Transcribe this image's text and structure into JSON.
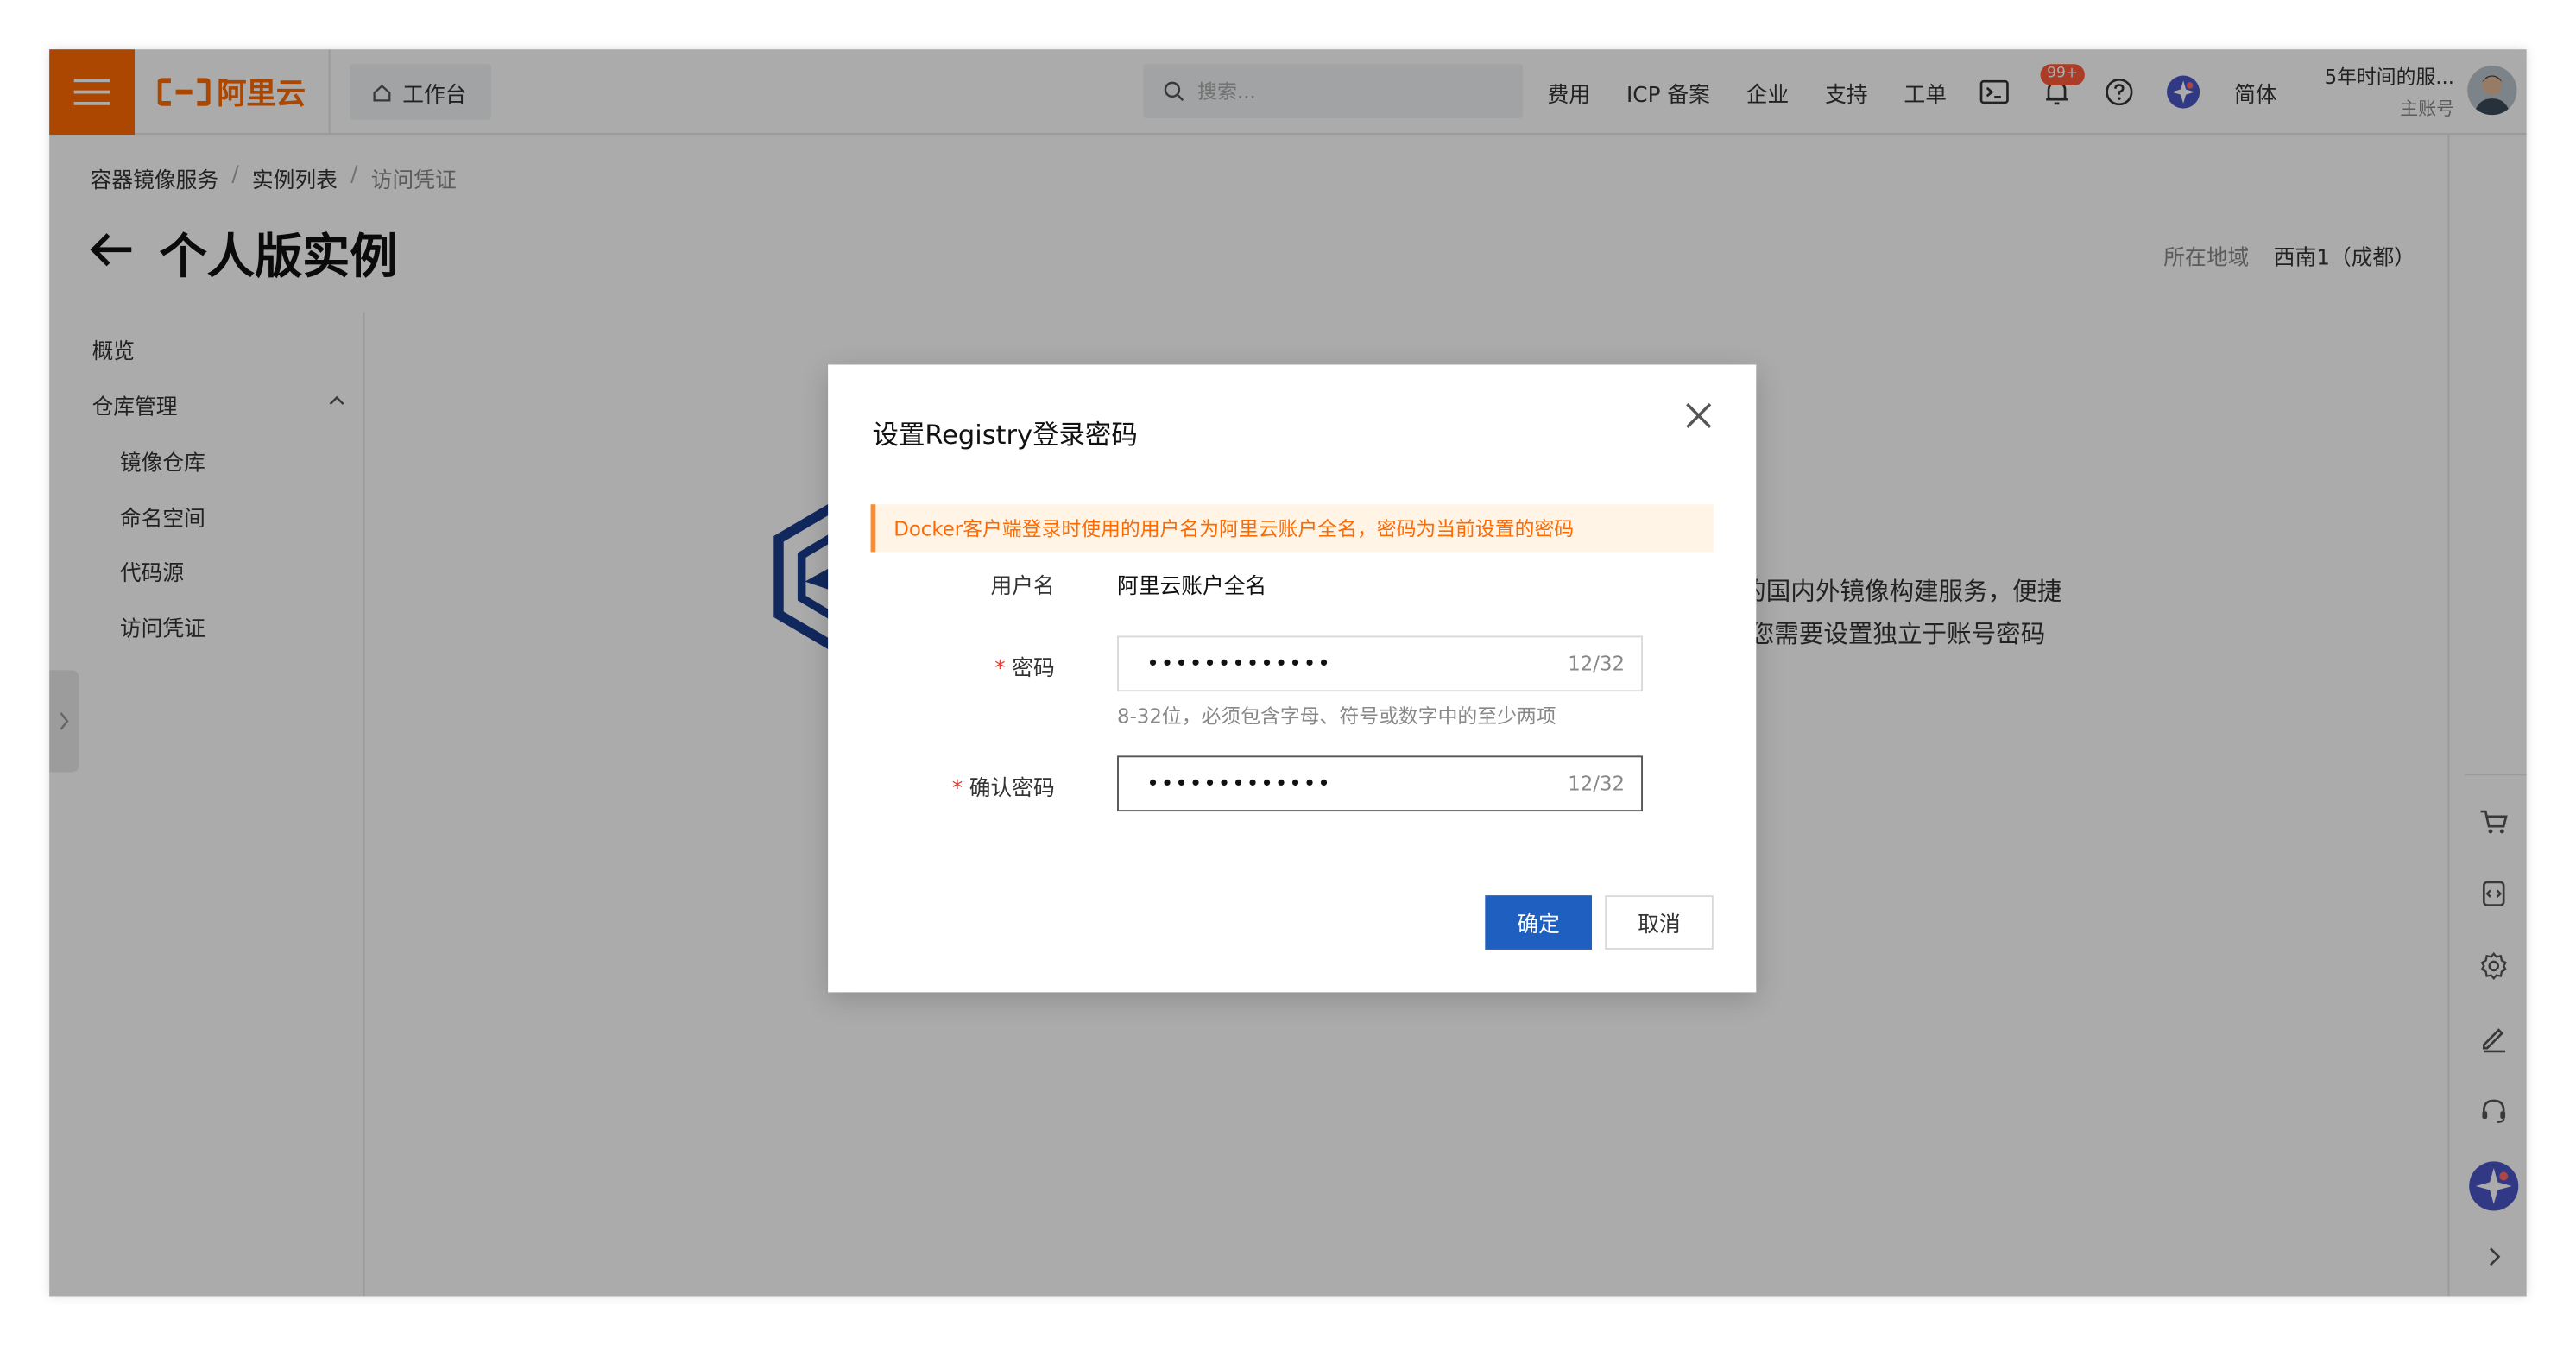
{
  "topbar": {
    "logo_text": "阿里云",
    "workbench_label": "工作台",
    "search_placeholder": "搜索...",
    "nav_links": [
      "费用",
      "ICP 备案",
      "企业",
      "支持",
      "工单"
    ],
    "notification_count": "99+",
    "language": "简体",
    "account_name": "5年时间的服...",
    "account_role": "主账号",
    "accent_color": "#ff6a00"
  },
  "breadcrumb": {
    "items": [
      "容器镜像服务",
      "实例列表",
      "访问凭证"
    ],
    "separator": "/"
  },
  "page": {
    "title": "个人版实例",
    "region_label": "所在地域",
    "region_value": "西南1（成都）"
  },
  "sidebar": {
    "overview": "概览",
    "repo_group": "仓库管理",
    "items": [
      "镜像仓库",
      "命名空间",
      "代码源",
      "访问凭证"
    ]
  },
  "background": {
    "line1": "的国内外镜像构建服务，便捷",
    "line2": "您需要设置独立于账号密码"
  },
  "dialog": {
    "title": "设置Registry登录密码",
    "alert": "Docker客户端登录时使用的用户名为阿里云账户全名，密码为当前设置的密码",
    "username_label": "用户名",
    "username_value": "阿里云账户全名",
    "password_label": "密码",
    "password_value": "•••••••••••••",
    "password_count": "12/32",
    "password_hint": "8-32位，必须包含字母、符号或数字中的至少两项",
    "confirm_label": "确认密码",
    "confirm_value": "•••••••••••••",
    "confirm_count": "12/32",
    "required_mark": "*",
    "ok_button": "确定",
    "cancel_button": "取消",
    "primary_color": "#1f5fbf"
  }
}
